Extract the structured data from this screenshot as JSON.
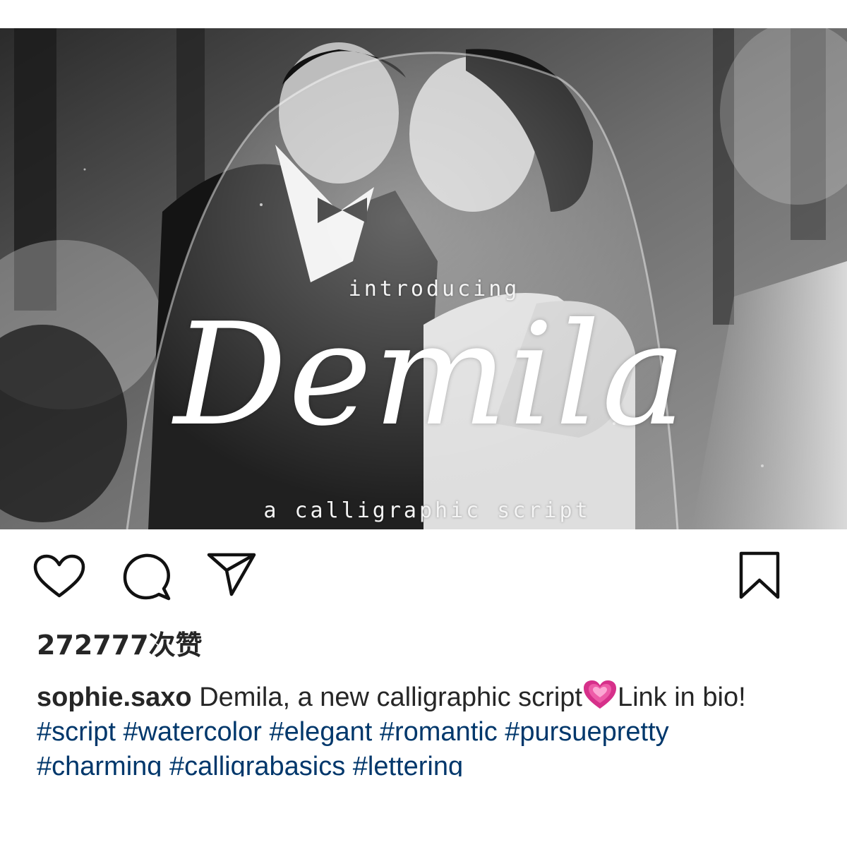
{
  "post": {
    "image": {
      "overlay_kicker": "introducing",
      "overlay_title": "Demila",
      "overlay_subtitle": "a calligraphic script"
    },
    "actions": {
      "like_icon": "heart-outline-icon",
      "comment_icon": "speech-bubble-icon",
      "share_icon": "paper-plane-icon",
      "save_icon": "bookmark-icon"
    },
    "likes_text": "272777次赞",
    "caption": {
      "username": "sophie.saxo",
      "text_before_emoji": " Demila, a new calligraphic script",
      "emoji_icon": "growing-heart-emoji",
      "text_after_emoji": "Link in bio! ",
      "hashtags": [
        "#script",
        "#watercolor",
        "#elegant",
        "#romantic",
        "#pursuepretty",
        "#charming",
        "#calligrabasics",
        "#lettering"
      ]
    }
  },
  "colors": {
    "text": "#262626",
    "hashtag": "#00376b",
    "emoji_pink": "#d6308a",
    "background": "#ffffff"
  }
}
